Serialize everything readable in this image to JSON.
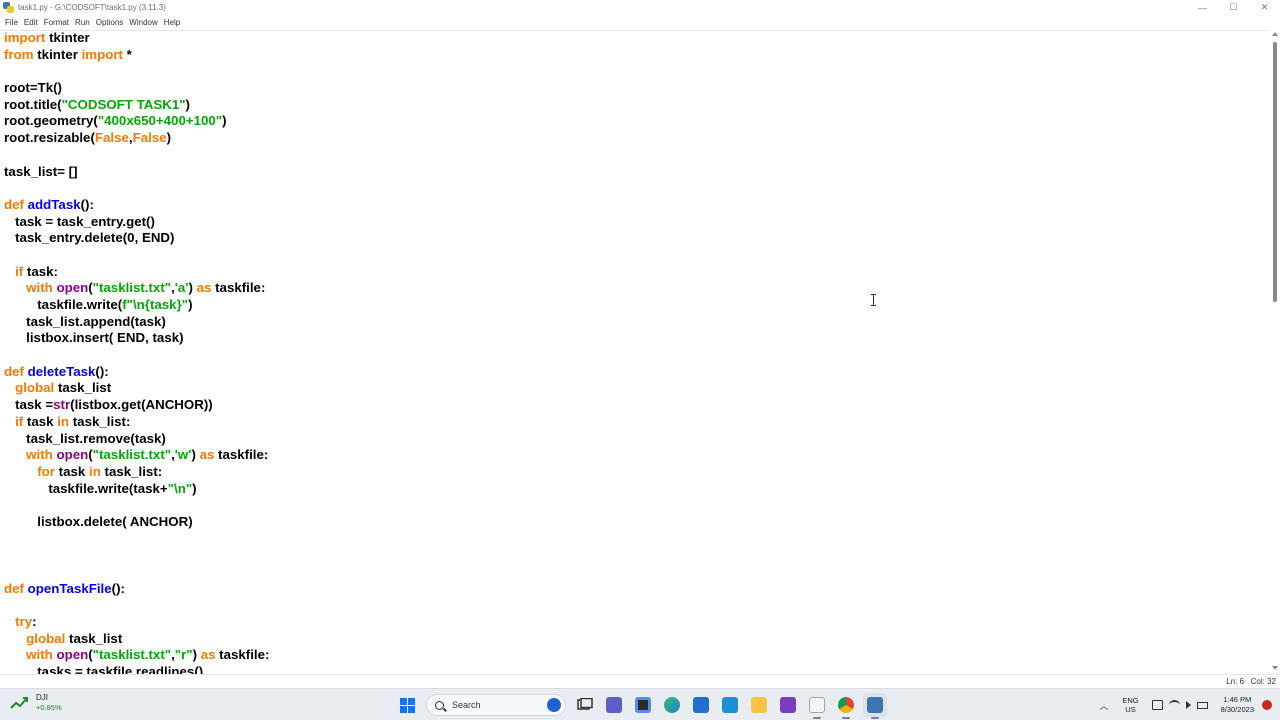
{
  "window": {
    "title": "task1.py - G:\\CODSOFT\\task1.py (3.11.3)",
    "controls": {
      "minimize": "—",
      "maximize": "☐",
      "close": "✕"
    }
  },
  "menu": [
    "File",
    "Edit",
    "Format",
    "Run",
    "Options",
    "Window",
    "Help"
  ],
  "code": [
    [
      {
        "t": "import",
        "c": "kw"
      },
      {
        "t": " tkinter",
        "c": ""
      }
    ],
    [
      {
        "t": "from",
        "c": "kw"
      },
      {
        "t": " tkinter ",
        "c": ""
      },
      {
        "t": "import",
        "c": "kw"
      },
      {
        "t": " *",
        "c": ""
      }
    ],
    [],
    [
      {
        "t": "root=Tk()",
        "c": ""
      }
    ],
    [
      {
        "t": "root.title(",
        "c": ""
      },
      {
        "t": "\"CODSOFT TASK1\"",
        "c": "str"
      },
      {
        "t": ")",
        "c": ""
      }
    ],
    [
      {
        "t": "root.geometry(",
        "c": ""
      },
      {
        "t": "\"400x650+400+100\"",
        "c": "str"
      },
      {
        "t": ")",
        "c": ""
      }
    ],
    [
      {
        "t": "root.resizable(",
        "c": ""
      },
      {
        "t": "False",
        "c": "kw"
      },
      {
        "t": ",",
        "c": ""
      },
      {
        "t": "False",
        "c": "kw"
      },
      {
        "t": ")",
        "c": ""
      }
    ],
    [],
    [
      {
        "t": "task_list= []",
        "c": ""
      }
    ],
    [],
    [
      {
        "t": "def",
        "c": "kw"
      },
      {
        "t": " ",
        "c": ""
      },
      {
        "t": "addTask",
        "c": "fn"
      },
      {
        "t": "():",
        "c": ""
      }
    ],
    [
      {
        "t": "   task = task_entry.get()",
        "c": ""
      }
    ],
    [
      {
        "t": "   task_entry.delete(0, END)",
        "c": ""
      }
    ],
    [],
    [
      {
        "t": "   ",
        "c": ""
      },
      {
        "t": "if",
        "c": "kw"
      },
      {
        "t": " task:",
        "c": ""
      }
    ],
    [
      {
        "t": "      ",
        "c": ""
      },
      {
        "t": "with",
        "c": "kw"
      },
      {
        "t": " ",
        "c": ""
      },
      {
        "t": "open",
        "c": "bi"
      },
      {
        "t": "(",
        "c": ""
      },
      {
        "t": "\"tasklist.txt\"",
        "c": "str"
      },
      {
        "t": ",",
        "c": ""
      },
      {
        "t": "'a'",
        "c": "str"
      },
      {
        "t": ") ",
        "c": ""
      },
      {
        "t": "as",
        "c": "kw"
      },
      {
        "t": " taskfile:",
        "c": ""
      }
    ],
    [
      {
        "t": "         taskfile.write(",
        "c": ""
      },
      {
        "t": "f\"\\n{task}\"",
        "c": "str"
      },
      {
        "t": ")",
        "c": ""
      }
    ],
    [
      {
        "t": "      task_list.append(task)",
        "c": ""
      }
    ],
    [
      {
        "t": "      listbox.insert( END, task)",
        "c": ""
      }
    ],
    [],
    [
      {
        "t": "def",
        "c": "kw"
      },
      {
        "t": " ",
        "c": ""
      },
      {
        "t": "deleteTask",
        "c": "fn"
      },
      {
        "t": "():",
        "c": ""
      }
    ],
    [
      {
        "t": "   ",
        "c": ""
      },
      {
        "t": "global",
        "c": "kw"
      },
      {
        "t": " task_list",
        "c": ""
      }
    ],
    [
      {
        "t": "   task =",
        "c": ""
      },
      {
        "t": "str",
        "c": "bi"
      },
      {
        "t": "(listbox.get(ANCHOR))",
        "c": ""
      }
    ],
    [
      {
        "t": "   ",
        "c": ""
      },
      {
        "t": "if",
        "c": "kw"
      },
      {
        "t": " task ",
        "c": ""
      },
      {
        "t": "in",
        "c": "kw"
      },
      {
        "t": " task_list:",
        "c": ""
      }
    ],
    [
      {
        "t": "      task_list.remove(task)",
        "c": ""
      }
    ],
    [
      {
        "t": "      ",
        "c": ""
      },
      {
        "t": "with",
        "c": "kw"
      },
      {
        "t": " ",
        "c": ""
      },
      {
        "t": "open",
        "c": "bi"
      },
      {
        "t": "(",
        "c": ""
      },
      {
        "t": "\"tasklist.txt\"",
        "c": "str"
      },
      {
        "t": ",",
        "c": ""
      },
      {
        "t": "'w'",
        "c": "str"
      },
      {
        "t": ") ",
        "c": ""
      },
      {
        "t": "as",
        "c": "kw"
      },
      {
        "t": " taskfile:",
        "c": ""
      }
    ],
    [
      {
        "t": "         ",
        "c": ""
      },
      {
        "t": "for",
        "c": "kw"
      },
      {
        "t": " task ",
        "c": ""
      },
      {
        "t": "in",
        "c": "kw"
      },
      {
        "t": " task_list:",
        "c": ""
      }
    ],
    [
      {
        "t": "            taskfile.write(task+",
        "c": ""
      },
      {
        "t": "\"\\n\"",
        "c": "str"
      },
      {
        "t": ")",
        "c": ""
      }
    ],
    [],
    [
      {
        "t": "         listbox.delete( ANCHOR)",
        "c": ""
      }
    ],
    [],
    [],
    [],
    [
      {
        "t": "def",
        "c": "kw"
      },
      {
        "t": " ",
        "c": ""
      },
      {
        "t": "openTaskFile",
        "c": "fn"
      },
      {
        "t": "():",
        "c": ""
      }
    ],
    [],
    [
      {
        "t": "   ",
        "c": ""
      },
      {
        "t": "try",
        "c": "kw"
      },
      {
        "t": ":",
        "c": ""
      }
    ],
    [
      {
        "t": "      ",
        "c": ""
      },
      {
        "t": "global",
        "c": "kw"
      },
      {
        "t": " task_list",
        "c": ""
      }
    ],
    [
      {
        "t": "      ",
        "c": ""
      },
      {
        "t": "with",
        "c": "kw"
      },
      {
        "t": " ",
        "c": ""
      },
      {
        "t": "open",
        "c": "bi"
      },
      {
        "t": "(",
        "c": ""
      },
      {
        "t": "\"tasklist.txt\"",
        "c": "str"
      },
      {
        "t": ",",
        "c": ""
      },
      {
        "t": "\"r\"",
        "c": "str"
      },
      {
        "t": ") ",
        "c": ""
      },
      {
        "t": "as",
        "c": "kw"
      },
      {
        "t": " taskfile:",
        "c": ""
      }
    ],
    [
      {
        "t": "         tasks = taskfile.readlines()",
        "c": ""
      }
    ]
  ],
  "status": {
    "line": "Ln: 6",
    "col": "Col: 32"
  },
  "taskbar": {
    "widget": {
      "label": "DJI",
      "change": "+0.85%"
    },
    "search_label": "Search",
    "lang": {
      "line1": "ENG",
      "line2": "US"
    },
    "time": "1:46 PM",
    "date": "8/30/2023"
  },
  "colors": {
    "keyword": "#ff7700",
    "string": "#00aa00",
    "function_def": "#0000ff",
    "builtin": "#900090"
  }
}
